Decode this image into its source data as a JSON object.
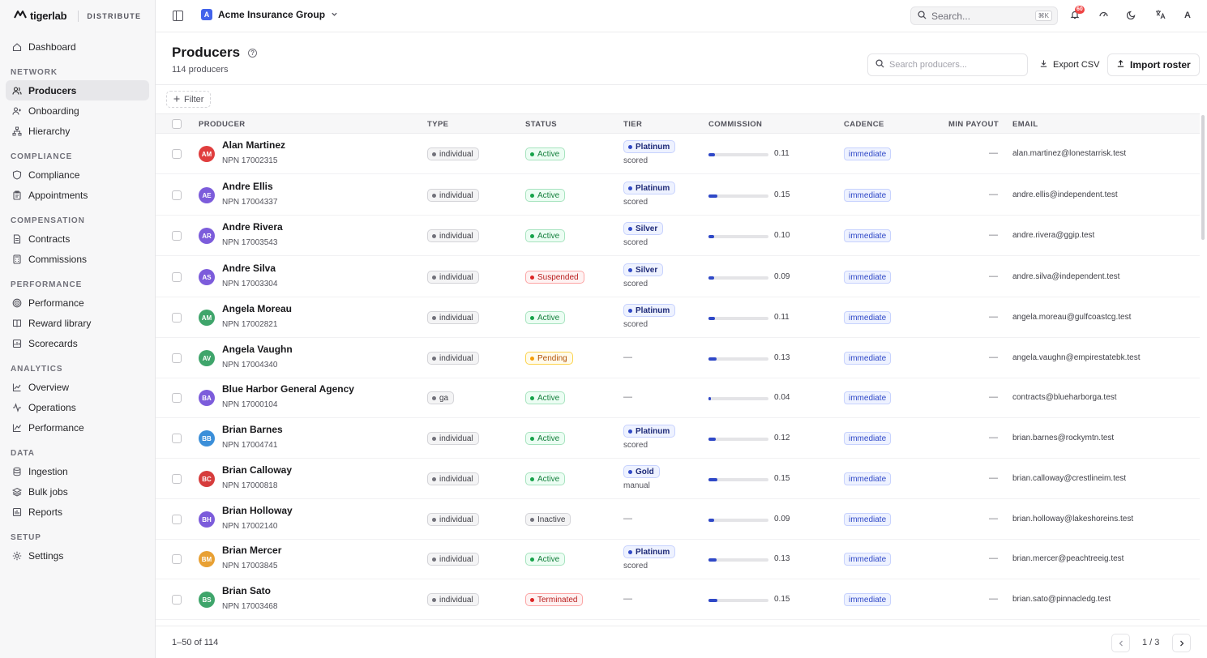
{
  "brand": {
    "name": "tigerlab",
    "product": "DISTRIBUTE"
  },
  "sidebar": {
    "top": [
      {
        "label": "Dashboard",
        "icon": "home-icon"
      }
    ],
    "sections": [
      {
        "title": "NETWORK",
        "items": [
          {
            "label": "Producers",
            "icon": "users-icon",
            "active": true
          },
          {
            "label": "Onboarding",
            "icon": "user-plus-icon"
          },
          {
            "label": "Hierarchy",
            "icon": "hierarchy-icon"
          }
        ]
      },
      {
        "title": "COMPLIANCE",
        "items": [
          {
            "label": "Compliance",
            "icon": "shield-icon"
          },
          {
            "label": "Appointments",
            "icon": "clipboard-icon"
          }
        ]
      },
      {
        "title": "COMPENSATION",
        "items": [
          {
            "label": "Contracts",
            "icon": "document-icon"
          },
          {
            "label": "Commissions",
            "icon": "calculator-icon"
          }
        ]
      },
      {
        "title": "PERFORMANCE",
        "items": [
          {
            "label": "Performance",
            "icon": "target-icon"
          },
          {
            "label": "Reward library",
            "icon": "book-icon"
          },
          {
            "label": "Scorecards",
            "icon": "scorecard-icon"
          }
        ]
      },
      {
        "title": "ANALYTICS",
        "items": [
          {
            "label": "Overview",
            "icon": "chart-line-icon"
          },
          {
            "label": "Operations",
            "icon": "activity-icon"
          },
          {
            "label": "Performance",
            "icon": "trend-icon"
          }
        ]
      },
      {
        "title": "DATA",
        "items": [
          {
            "label": "Ingestion",
            "icon": "database-icon"
          },
          {
            "label": "Bulk jobs",
            "icon": "layers-icon"
          },
          {
            "label": "Reports",
            "icon": "bar-chart-icon"
          }
        ]
      },
      {
        "title": "SETUP",
        "items": [
          {
            "label": "Settings",
            "icon": "gear-icon"
          }
        ]
      }
    ]
  },
  "topbar": {
    "org_initial": "A",
    "org_name": "Acme Insurance Group",
    "search_placeholder": "Search...",
    "search_shortcut": "⌘K",
    "notifications_count": "60",
    "user_initial": "A"
  },
  "page": {
    "title": "Producers",
    "count_label": "114 producers",
    "search_placeholder": "Search producers...",
    "export_label": "Export CSV",
    "import_label": "Import roster",
    "filter_label": "Filter"
  },
  "table": {
    "columns": [
      "PRODUCER",
      "TYPE",
      "STATUS",
      "TIER",
      "COMMISSION",
      "CADENCE",
      "MIN PAYOUT",
      "EMAIL"
    ],
    "rows": [
      {
        "initials": "AM",
        "avatar_color": "#e03e3e",
        "name": "Alan Martinez",
        "npn": "NPN 17002315",
        "type": "individual",
        "status": "Active",
        "tier": "Platinum",
        "tier_source": "scored",
        "commission": "0.11",
        "cadence": "immediate",
        "min_payout": "—",
        "email": "alan.martinez@lonestarrisk.test"
      },
      {
        "initials": "AE",
        "avatar_color": "#7c5cdb",
        "name": "Andre Ellis",
        "npn": "NPN 17004337",
        "type": "individual",
        "status": "Active",
        "tier": "Platinum",
        "tier_source": "scored",
        "commission": "0.15",
        "cadence": "immediate",
        "min_payout": "—",
        "email": "andre.ellis@independent.test"
      },
      {
        "initials": "AR",
        "avatar_color": "#7c5cdb",
        "name": "Andre Rivera",
        "npn": "NPN 17003543",
        "type": "individual",
        "status": "Active",
        "tier": "Silver",
        "tier_source": "scored",
        "commission": "0.10",
        "cadence": "immediate",
        "min_payout": "—",
        "email": "andre.rivera@ggip.test"
      },
      {
        "initials": "AS",
        "avatar_color": "#7c5cdb",
        "name": "Andre Silva",
        "npn": "NPN 17003304",
        "type": "individual",
        "status": "Suspended",
        "tier": "Silver",
        "tier_source": "scored",
        "commission": "0.09",
        "cadence": "immediate",
        "min_payout": "—",
        "email": "andre.silva@independent.test"
      },
      {
        "initials": "AM",
        "avatar_color": "#3fa56b",
        "name": "Angela Moreau",
        "npn": "NPN 17002821",
        "type": "individual",
        "status": "Active",
        "tier": "Platinum",
        "tier_source": "scored",
        "commission": "0.11",
        "cadence": "immediate",
        "min_payout": "—",
        "email": "angela.moreau@gulfcoastcg.test"
      },
      {
        "initials": "AV",
        "avatar_color": "#3fa56b",
        "name": "Angela Vaughn",
        "npn": "NPN 17004340",
        "type": "individual",
        "status": "Pending",
        "tier": "",
        "tier_source": "",
        "commission": "0.13",
        "cadence": "immediate",
        "min_payout": "—",
        "email": "angela.vaughn@empirestatebk.test"
      },
      {
        "initials": "BA",
        "avatar_color": "#7c5cdb",
        "name": "Blue Harbor General Agency",
        "npn": "NPN 17000104",
        "type": "ga",
        "status": "Active",
        "tier": "",
        "tier_source": "",
        "commission": "0.04",
        "cadence": "immediate",
        "min_payout": "—",
        "email": "contracts@blueharborga.test"
      },
      {
        "initials": "BB",
        "avatar_color": "#3b8fd9",
        "name": "Brian Barnes",
        "npn": "NPN 17004741",
        "type": "individual",
        "status": "Active",
        "tier": "Platinum",
        "tier_source": "scored",
        "commission": "0.12",
        "cadence": "immediate",
        "min_payout": "—",
        "email": "brian.barnes@rockymtn.test"
      },
      {
        "initials": "BC",
        "avatar_color": "#d63c3c",
        "name": "Brian Calloway",
        "npn": "NPN 17000818",
        "type": "individual",
        "status": "Active",
        "tier": "Gold",
        "tier_source": "manual",
        "commission": "0.15",
        "cadence": "immediate",
        "min_payout": "—",
        "email": "brian.calloway@crestlineim.test"
      },
      {
        "initials": "BH",
        "avatar_color": "#7c5cdb",
        "name": "Brian Holloway",
        "npn": "NPN 17002140",
        "type": "individual",
        "status": "Inactive",
        "tier": "",
        "tier_source": "",
        "commission": "0.09",
        "cadence": "immediate",
        "min_payout": "—",
        "email": "brian.holloway@lakeshoreins.test"
      },
      {
        "initials": "BM",
        "avatar_color": "#e8a033",
        "name": "Brian Mercer",
        "npn": "NPN 17003845",
        "type": "individual",
        "status": "Active",
        "tier": "Platinum",
        "tier_source": "scored",
        "commission": "0.13",
        "cadence": "immediate",
        "min_payout": "—",
        "email": "brian.mercer@peachtreeig.test"
      },
      {
        "initials": "BS",
        "avatar_color": "#3fa56b",
        "name": "Brian Sato",
        "npn": "NPN 17003468",
        "type": "individual",
        "status": "Terminated",
        "tier": "",
        "tier_source": "",
        "commission": "0.15",
        "cadence": "immediate",
        "min_payout": "—",
        "email": "brian.sato@pinnacledg.test"
      }
    ],
    "empty_value": "—"
  },
  "status_colors": {
    "Active": {
      "bg": "#ecfdf3",
      "border": "#a7e3bf",
      "text": "#15803d",
      "dot": "#16a34a"
    },
    "Suspended": {
      "bg": "#fef2f2",
      "border": "#fca5a5",
      "text": "#b91c1c",
      "dot": "#dc2626"
    },
    "Terminated": {
      "bg": "#fef2f2",
      "border": "#fca5a5",
      "text": "#b91c1c",
      "dot": "#dc2626"
    },
    "Pending": {
      "bg": "#fffbeb",
      "border": "#fcd34d",
      "text": "#b45309",
      "dot": "#f59e0b"
    },
    "Inactive": {
      "bg": "#f4f4f5",
      "border": "#d4d4d8",
      "text": "#3f3f46",
      "dot": "#71717a"
    }
  },
  "footer": {
    "range_label": "1–50 of 114",
    "page_label": "1 / 3"
  }
}
